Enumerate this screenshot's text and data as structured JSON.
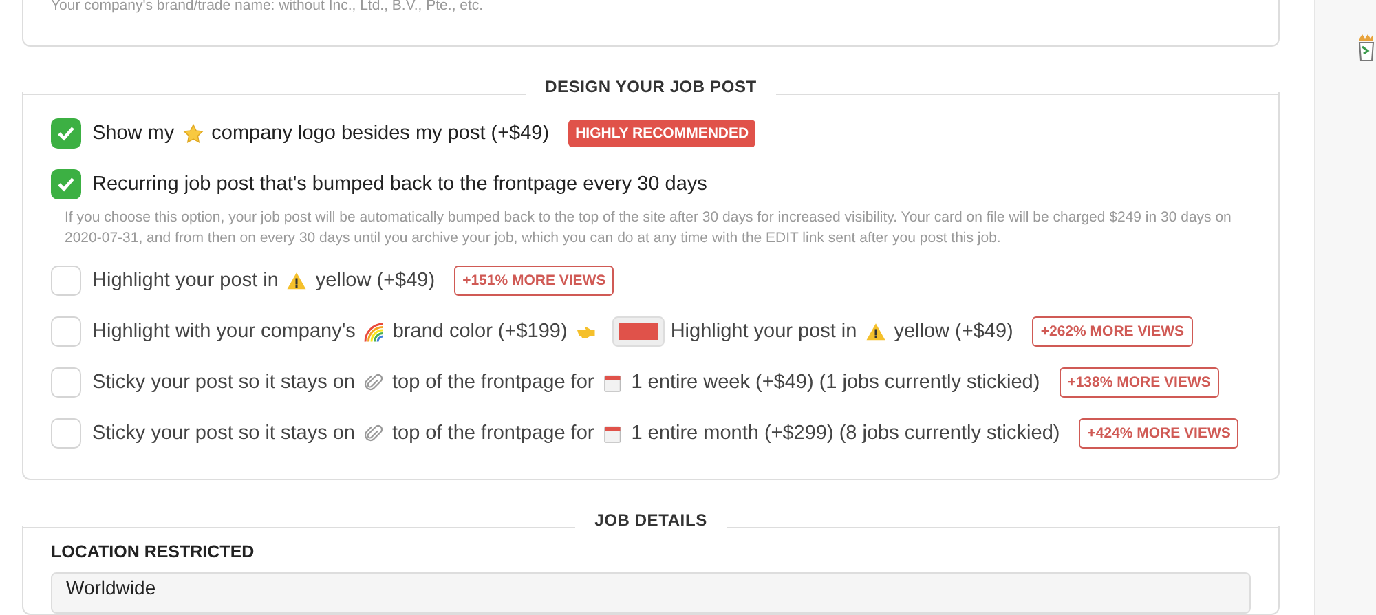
{
  "company_name_hint": "Your company's brand/trade name: without Inc., Ltd., B.V., Pte., etc.",
  "design_section": {
    "title": "DESIGN YOUR JOB POST",
    "options": [
      {
        "checked": true,
        "parts": [
          {
            "kind": "text",
            "text": "Show my"
          },
          {
            "kind": "icon"
          },
          {
            "kind": "text",
            "text": "company logo besides my post (+$49)"
          }
        ],
        "badge": {
          "kind": "recommendation",
          "text": "HIGHLY RECOMMENDED"
        }
      },
      {
        "checked": true,
        "parts": [
          {
            "kind": "text",
            "text": "Recurring job post that's bumped back to the frontpage every 30 days"
          }
        ],
        "note": "If you choose this option, your job post will be automatically bumped back to the top of the site after 30 days for increased visibility. Your card on file will be charged $249 in 30 days on 2020-07-31, and from then on every 30 days until you archive your job, which you can do at any time with the EDIT link sent after you post this job."
      },
      {
        "checked": false,
        "parts": [
          {
            "kind": "text",
            "text": "Highlight your post in"
          },
          {
            "kind": "icon"
          },
          {
            "kind": "text",
            "text": "yellow (+$49)"
          }
        ],
        "badge": {
          "kind": "stat",
          "text": "+151% MORE VIEWS"
        }
      },
      {
        "checked": false,
        "parts": [
          {
            "kind": "text",
            "text": "Highlight with your company's"
          },
          {
            "kind": "icon"
          },
          {
            "kind": "text",
            "text": "brand color (+$199)"
          },
          {
            "kind": "icon"
          },
          {
            "kind": "swatch",
            "color": "#e0524a"
          },
          {
            "kind": "text",
            "text": "Highlight your post in"
          },
          {
            "kind": "icon"
          },
          {
            "kind": "text",
            "text": "yellow (+$49)"
          }
        ],
        "badge": {
          "kind": "stat",
          "text": "+262% MORE VIEWS"
        }
      },
      {
        "checked": false,
        "parts": [
          {
            "kind": "text",
            "text": "Sticky your post so it stays on"
          },
          {
            "kind": "icon"
          },
          {
            "kind": "text",
            "text": "top of the frontpage for"
          },
          {
            "kind": "icon"
          },
          {
            "kind": "text",
            "text": "1 entire week (+$49) (1 jobs currently stickied)"
          }
        ],
        "badge": {
          "kind": "stat",
          "text": "+138% MORE VIEWS"
        }
      },
      {
        "checked": false,
        "parts": [
          {
            "kind": "text",
            "text": "Sticky your post so it stays on"
          },
          {
            "kind": "icon"
          },
          {
            "kind": "text",
            "text": "top of the frontpage for"
          },
          {
            "kind": "icon"
          },
          {
            "kind": "text",
            "text": "1 entire month (+$299) (8 jobs currently stickied)"
          }
        ],
        "badge": {
          "kind": "stat",
          "text": "+424% MORE VIEWS"
        }
      }
    ]
  },
  "details_section": {
    "title": "JOB DETAILS",
    "location_label": "LOCATION RESTRICTED",
    "location_value": "Worldwide"
  }
}
